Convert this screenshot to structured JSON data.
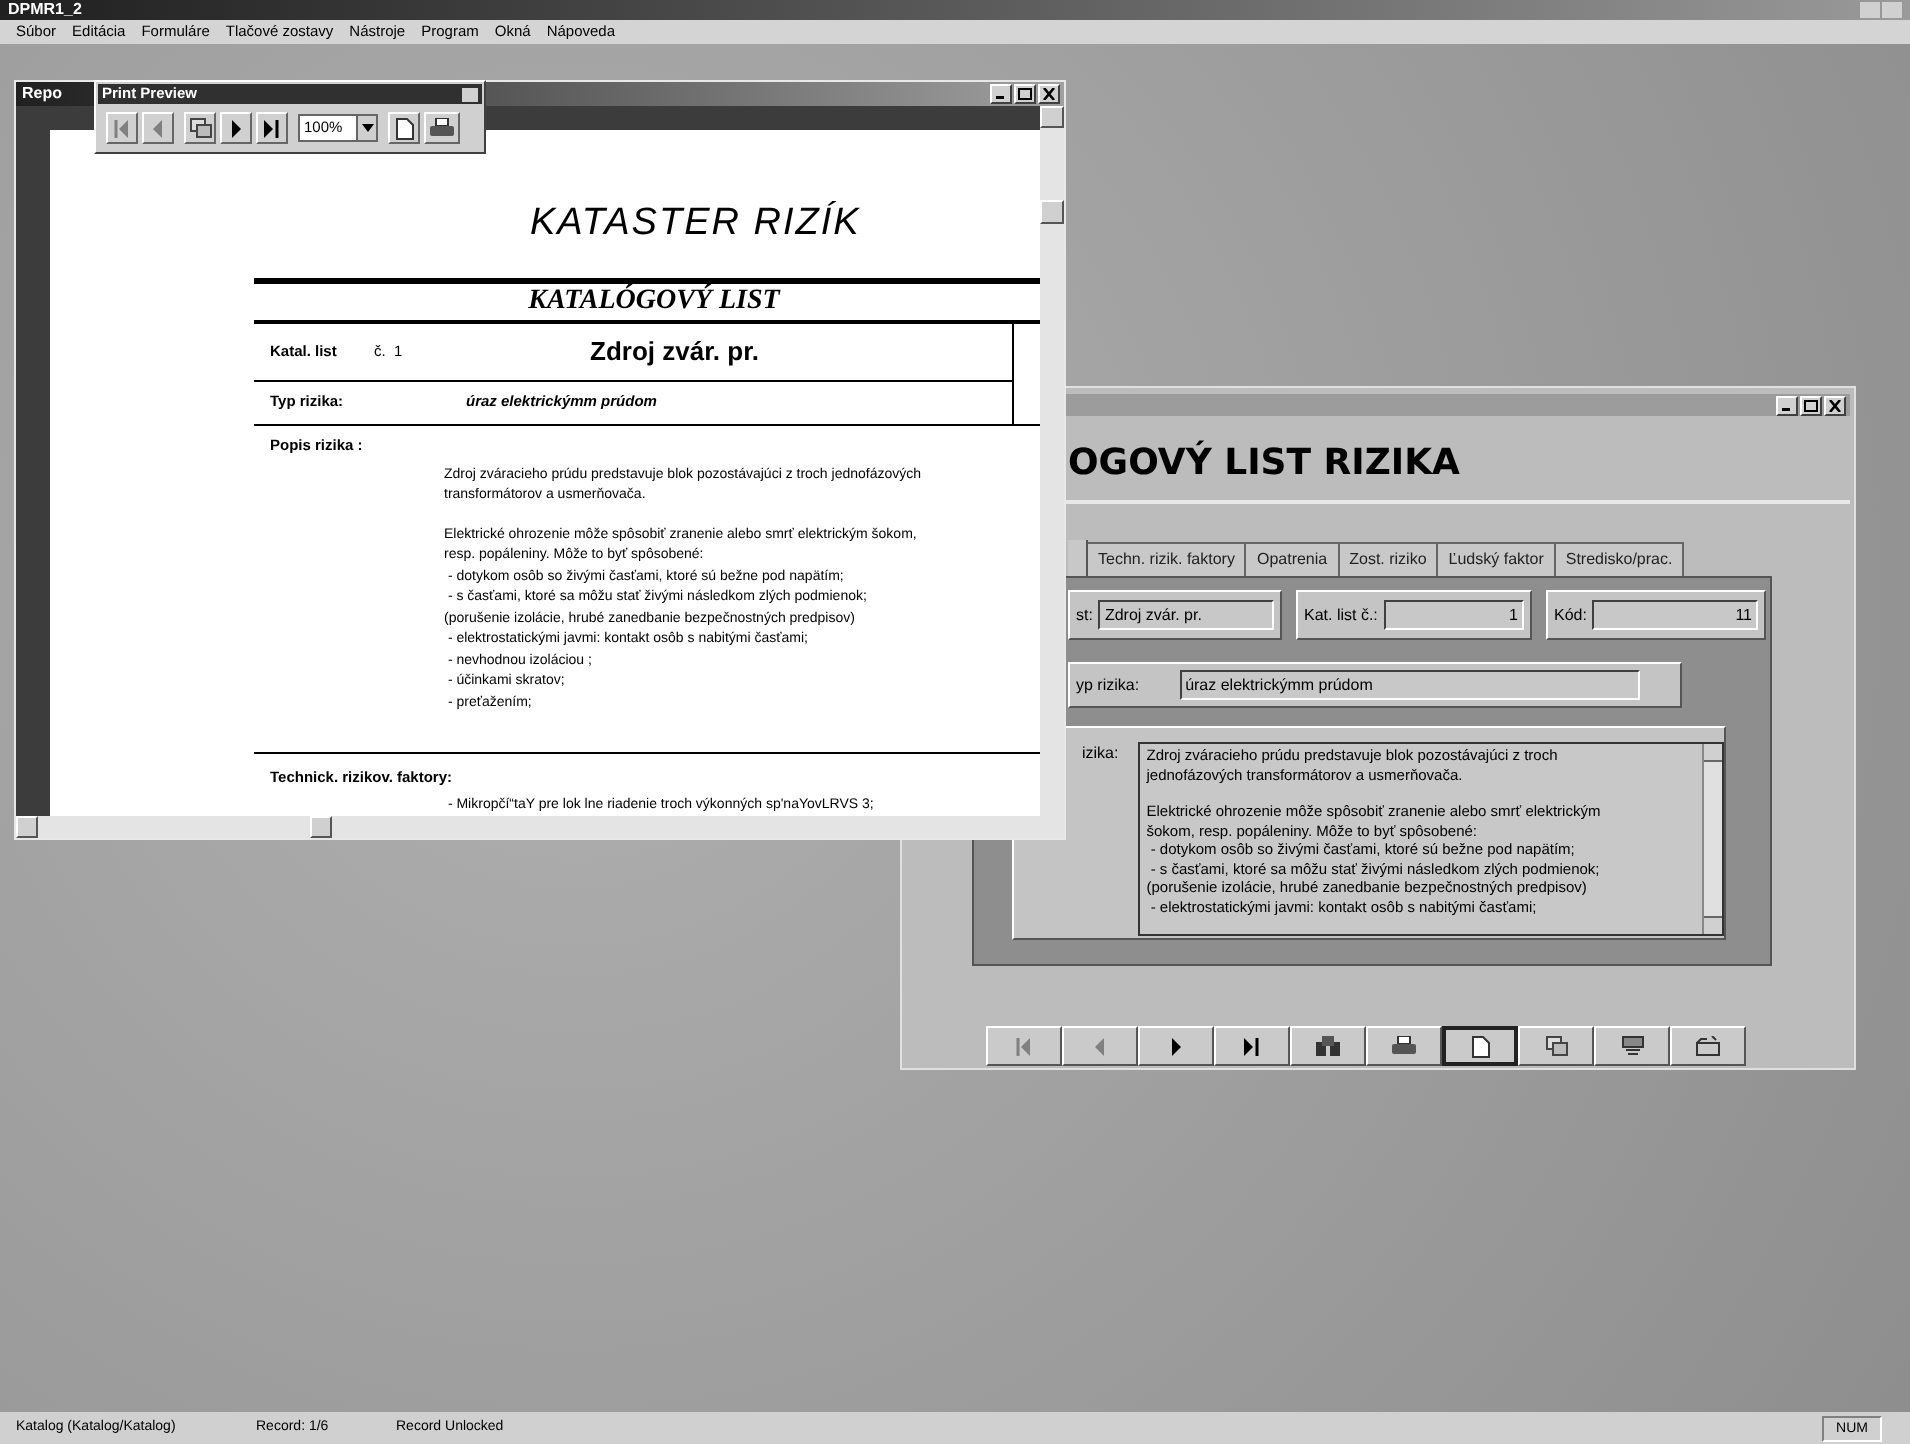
{
  "app": {
    "title": "DPMR1_2"
  },
  "menu": [
    "Súbor",
    "Editácia",
    "Formuláre",
    "Tlačové zostavy",
    "Nástroje",
    "Program",
    "Okná",
    "Nápoveda"
  ],
  "report_window": {
    "title": "Repo",
    "report": {
      "title": "KATASTER RIZÍK",
      "heading": "KATALÓGOVÝ LIST",
      "catalog_label": "Katal. list",
      "number_label": "č.",
      "number": "1",
      "source": "Zdroj zvár. pr.",
      "type_label": "Typ rizika:",
      "type": "úraz elektrickýmm prúdom",
      "description_label": "Popis rizika :",
      "description": [
        [
          "Zdroj zváracieho prúdu predstavuje blok pozostávajúci z troch jednofázových",
          "transformátorov a usmerňovača."
        ],
        [
          "Elektrické ohrozenie môže spôsobiť zranenie alebo smrť elektrickým šokom,",
          "resp. popáleniny. Môže to byť spôsobené:",
          " - dotykom osôb so živými časťami, ktoré sú bežne pod napätím;",
          " - s časťami, ktoré sa môžu stať živými následkom zlých podmienok;",
          "(porušenie izolácie, hrubé zanedbanie bezpečnostných predpisov)",
          " - elektrostatickými javmi: kontakt osôb s nabitými časťami;",
          " - nevhodnou izoláciou ;",
          " - účinkami skratov;",
          " - preťažením;"
        ]
      ],
      "factors_label": "Technick. rizikov. faktory:",
      "factors": [
        " - Mikropčí“taY pre lok lne riadenie troch výkonných sp'naYovLRVS 3;"
      ]
    }
  },
  "print_preview_toolbar": {
    "title": "Print Preview",
    "zoom": "100%"
  },
  "form_window": {
    "heading": "OGOVÝ LIST RIZIKA",
    "tabs": [
      {
        "label": "Techn. rizik. faktory",
        "selected": false
      },
      {
        "label": "Opatrenia",
        "selected": false
      },
      {
        "label": "Zost. riziko",
        "selected": false
      },
      {
        "label": "Ľudský faktor",
        "selected": false
      },
      {
        "label": "Stredisko/prac.",
        "selected": false
      }
    ],
    "fields": [
      {
        "label": "st:",
        "value": "Zdroj zvár. pr.",
        "kind": "text"
      },
      {
        "label": "Kat. list č.:",
        "value": "1",
        "kind": "number"
      },
      {
        "label": "Kód:",
        "value": "11",
        "kind": "number"
      }
    ],
    "risk_type": {
      "label": "yp rizika:",
      "value": "úraz elektrickýmm prúdom"
    },
    "description": {
      "label": "izika:",
      "paragraphs": [
        [
          "Zdroj zváracieho prúdu predstavuje blok pozostávajúci z troch",
          "jednofázových transformátorov a usmerňovača."
        ],
        [
          "Elektrické ohrozenie môže spôsobiť zranenie alebo smrť elektrickým",
          "šokom, resp. popáleniny. Môže to byť spôsobené:",
          " - dotykom osôb so živými časťami, ktoré sú bežne pod napätím;",
          " - s časťami, ktoré sa môžu stať živými následkom zlých podmienok;",
          "(porušenie izolácie, hrubé zanedbanie bezpečnostných predpisov)",
          " - elektrostatickými javmi: kontakt osôb s nabitými časťami;"
        ]
      ]
    },
    "nav_buttons": [
      {
        "kind": "first",
        "focused": false
      },
      {
        "kind": "previous",
        "focused": false
      },
      {
        "kind": "next",
        "focused": false
      },
      {
        "kind": "last",
        "focused": false
      },
      {
        "kind": "find",
        "focused": false
      },
      {
        "kind": "print",
        "focused": false
      },
      {
        "kind": "new",
        "focused": true
      },
      {
        "kind": "copy",
        "focused": false
      },
      {
        "kind": "delete",
        "focused": false
      },
      {
        "kind": "close",
        "focused": false
      }
    ]
  },
  "status_bar": {
    "form": "Katalog (Katalog/Katalog)",
    "record": "Record: 1/6",
    "lock": "Record Unlocked",
    "keyboard": "NUM"
  }
}
